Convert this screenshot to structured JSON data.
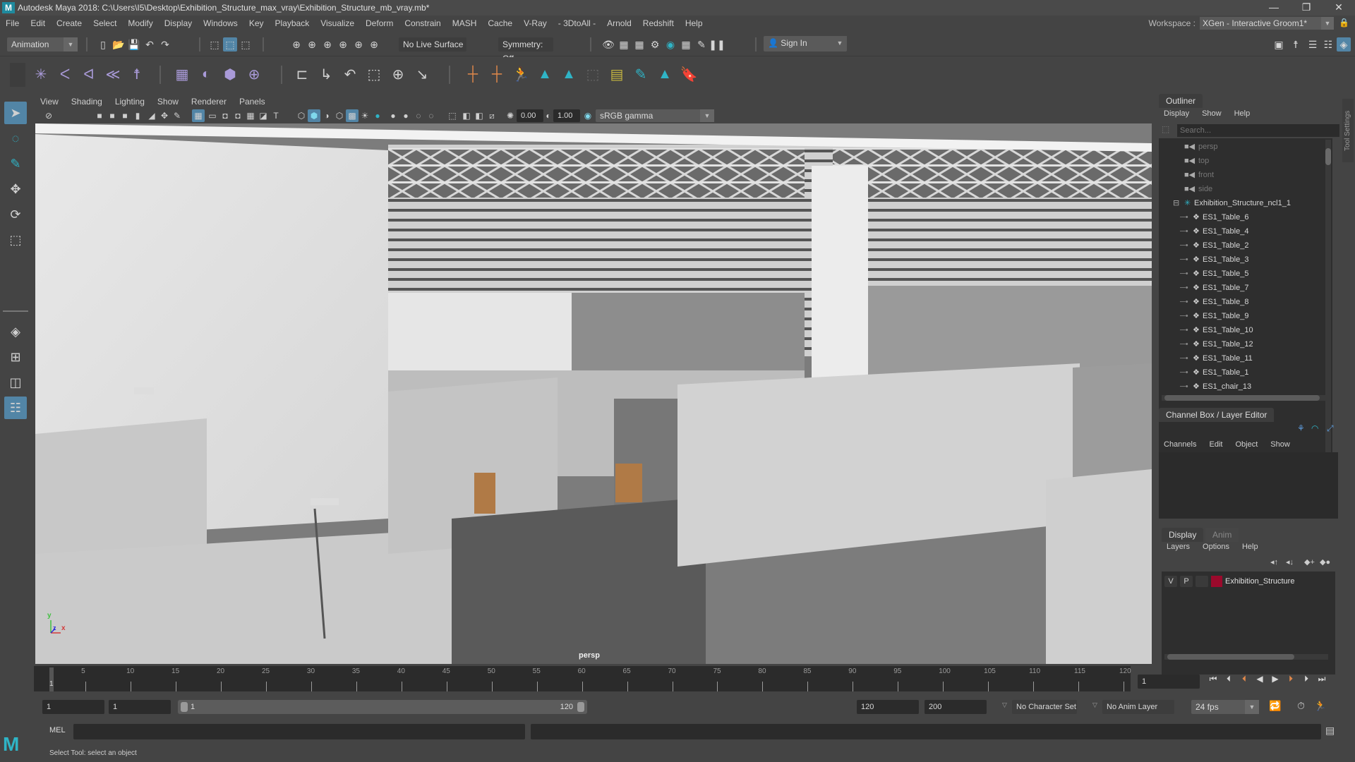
{
  "window": {
    "title": "Autodesk Maya 2018: C:\\Users\\I5\\Desktop\\Exhibition_Structure_max_vray\\Exhibition_Structure_mb_vray.mb*",
    "app_logo": "M",
    "minimize": "—",
    "restore": "❐",
    "close": "✕"
  },
  "menubar": {
    "items": [
      "File",
      "Edit",
      "Create",
      "Select",
      "Modify",
      "Display",
      "Windows",
      "Key",
      "Playback",
      "Visualize",
      "Deform",
      "Constrain",
      "MASH",
      "Cache",
      "V-Ray",
      "- 3DtoAll -",
      "Arnold",
      "Redshift",
      "Help"
    ],
    "workspace_label": "Workspace :",
    "workspace_value": "XGen - Interactive Groom1*"
  },
  "statusline": {
    "menuset": "Animation",
    "live_surface": "No Live Surface",
    "symmetry": "Symmetry: Off",
    "sign_in": "Sign In"
  },
  "panel": {
    "menus": [
      "View",
      "Shading",
      "Lighting",
      "Show",
      "Renderer",
      "Panels"
    ],
    "exposure": "0.00",
    "gamma": "1.00",
    "color_space": "sRGB gamma",
    "camera_label": "persp",
    "axis": {
      "x": "x",
      "y": "y",
      "z": "z"
    }
  },
  "outliner": {
    "title": "Outliner",
    "menus": [
      "Display",
      "Show",
      "Help"
    ],
    "search_placeholder": "Search...",
    "cameras": [
      "persp",
      "top",
      "front",
      "side"
    ],
    "group": "Exhibition_Structure_ncl1_1",
    "children": [
      "ES1_Table_6",
      "ES1_Table_4",
      "ES1_Table_2",
      "ES1_Table_3",
      "ES1_Table_5",
      "ES1_Table_7",
      "ES1_Table_8",
      "ES1_Table_9",
      "ES1_Table_10",
      "ES1_Table_12",
      "ES1_Table_11",
      "ES1_Table_1",
      "ES1_chair_13"
    ]
  },
  "tool_settings_tab": "Tool Settings",
  "channel_box": {
    "title": "Channel Box / Layer Editor",
    "menus": [
      "Channels",
      "Edit",
      "Object",
      "Show"
    ]
  },
  "layer_editor": {
    "tabs": [
      "Display",
      "Anim"
    ],
    "menus": [
      "Layers",
      "Options",
      "Help"
    ],
    "layers": [
      {
        "v": "V",
        "p": "P",
        "name": "Exhibition_Structure",
        "color": "#9b0a2c"
      }
    ]
  },
  "timeline": {
    "ticks": [
      5,
      10,
      15,
      20,
      25,
      30,
      35,
      40,
      45,
      50,
      55,
      60,
      65,
      70,
      75,
      80,
      85,
      90,
      95,
      100,
      105,
      110,
      115,
      120
    ],
    "current_frame_marker": "1",
    "current_frame": "1",
    "range_start_outer": "1",
    "range_start_inner": "1",
    "slider_start": "1",
    "slider_end": "120",
    "range_end_inner": "120",
    "range_end_outer": "200",
    "character_set": "No Character Set",
    "anim_layer": "No Anim Layer",
    "fps": "24 fps"
  },
  "command_line": {
    "language": "MEL"
  },
  "help_line": "Select Tool: select an object",
  "colors": {
    "accent": "#5285a6",
    "teal": "#2fb4c6",
    "orange": "#e0884a",
    "layer_red": "#9b0a2c"
  }
}
